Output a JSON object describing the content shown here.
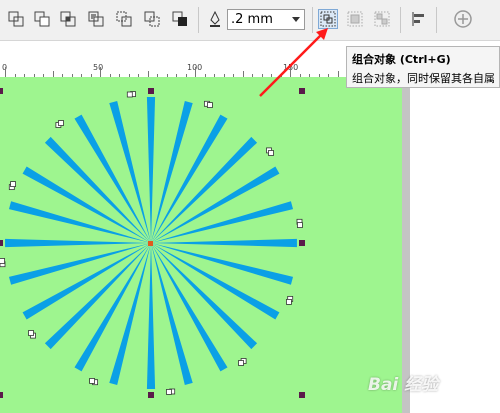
{
  "toolbar": {
    "outline_width": ".2 mm",
    "icons": [
      "weld-icon",
      "trim-icon",
      "intersect-icon",
      "simplify-icon",
      "front-minus-back-icon",
      "back-minus-front-icon",
      "create-boundary-icon",
      "pen-outline-icon",
      "group-objects-icon",
      "ungroup-icon",
      "ungroup-all-icon",
      "align-distribute-icon",
      "add-icon"
    ]
  },
  "tooltip": {
    "title": "组合对象 (Ctrl+G)",
    "description": "组合对象，同时保留其各自属"
  },
  "ruler": {
    "labels": [
      "0",
      "50",
      "100",
      "150"
    ]
  },
  "canvas": {
    "background": "#9ef58f",
    "ray_color": "#0aa0e6",
    "ray_count": 24,
    "center_color": "#e05a1e"
  },
  "watermark": {
    "text": "Bai 经验"
  },
  "colors": {
    "arrow": "#ff1a1a",
    "handle": "#5a1a4a"
  }
}
